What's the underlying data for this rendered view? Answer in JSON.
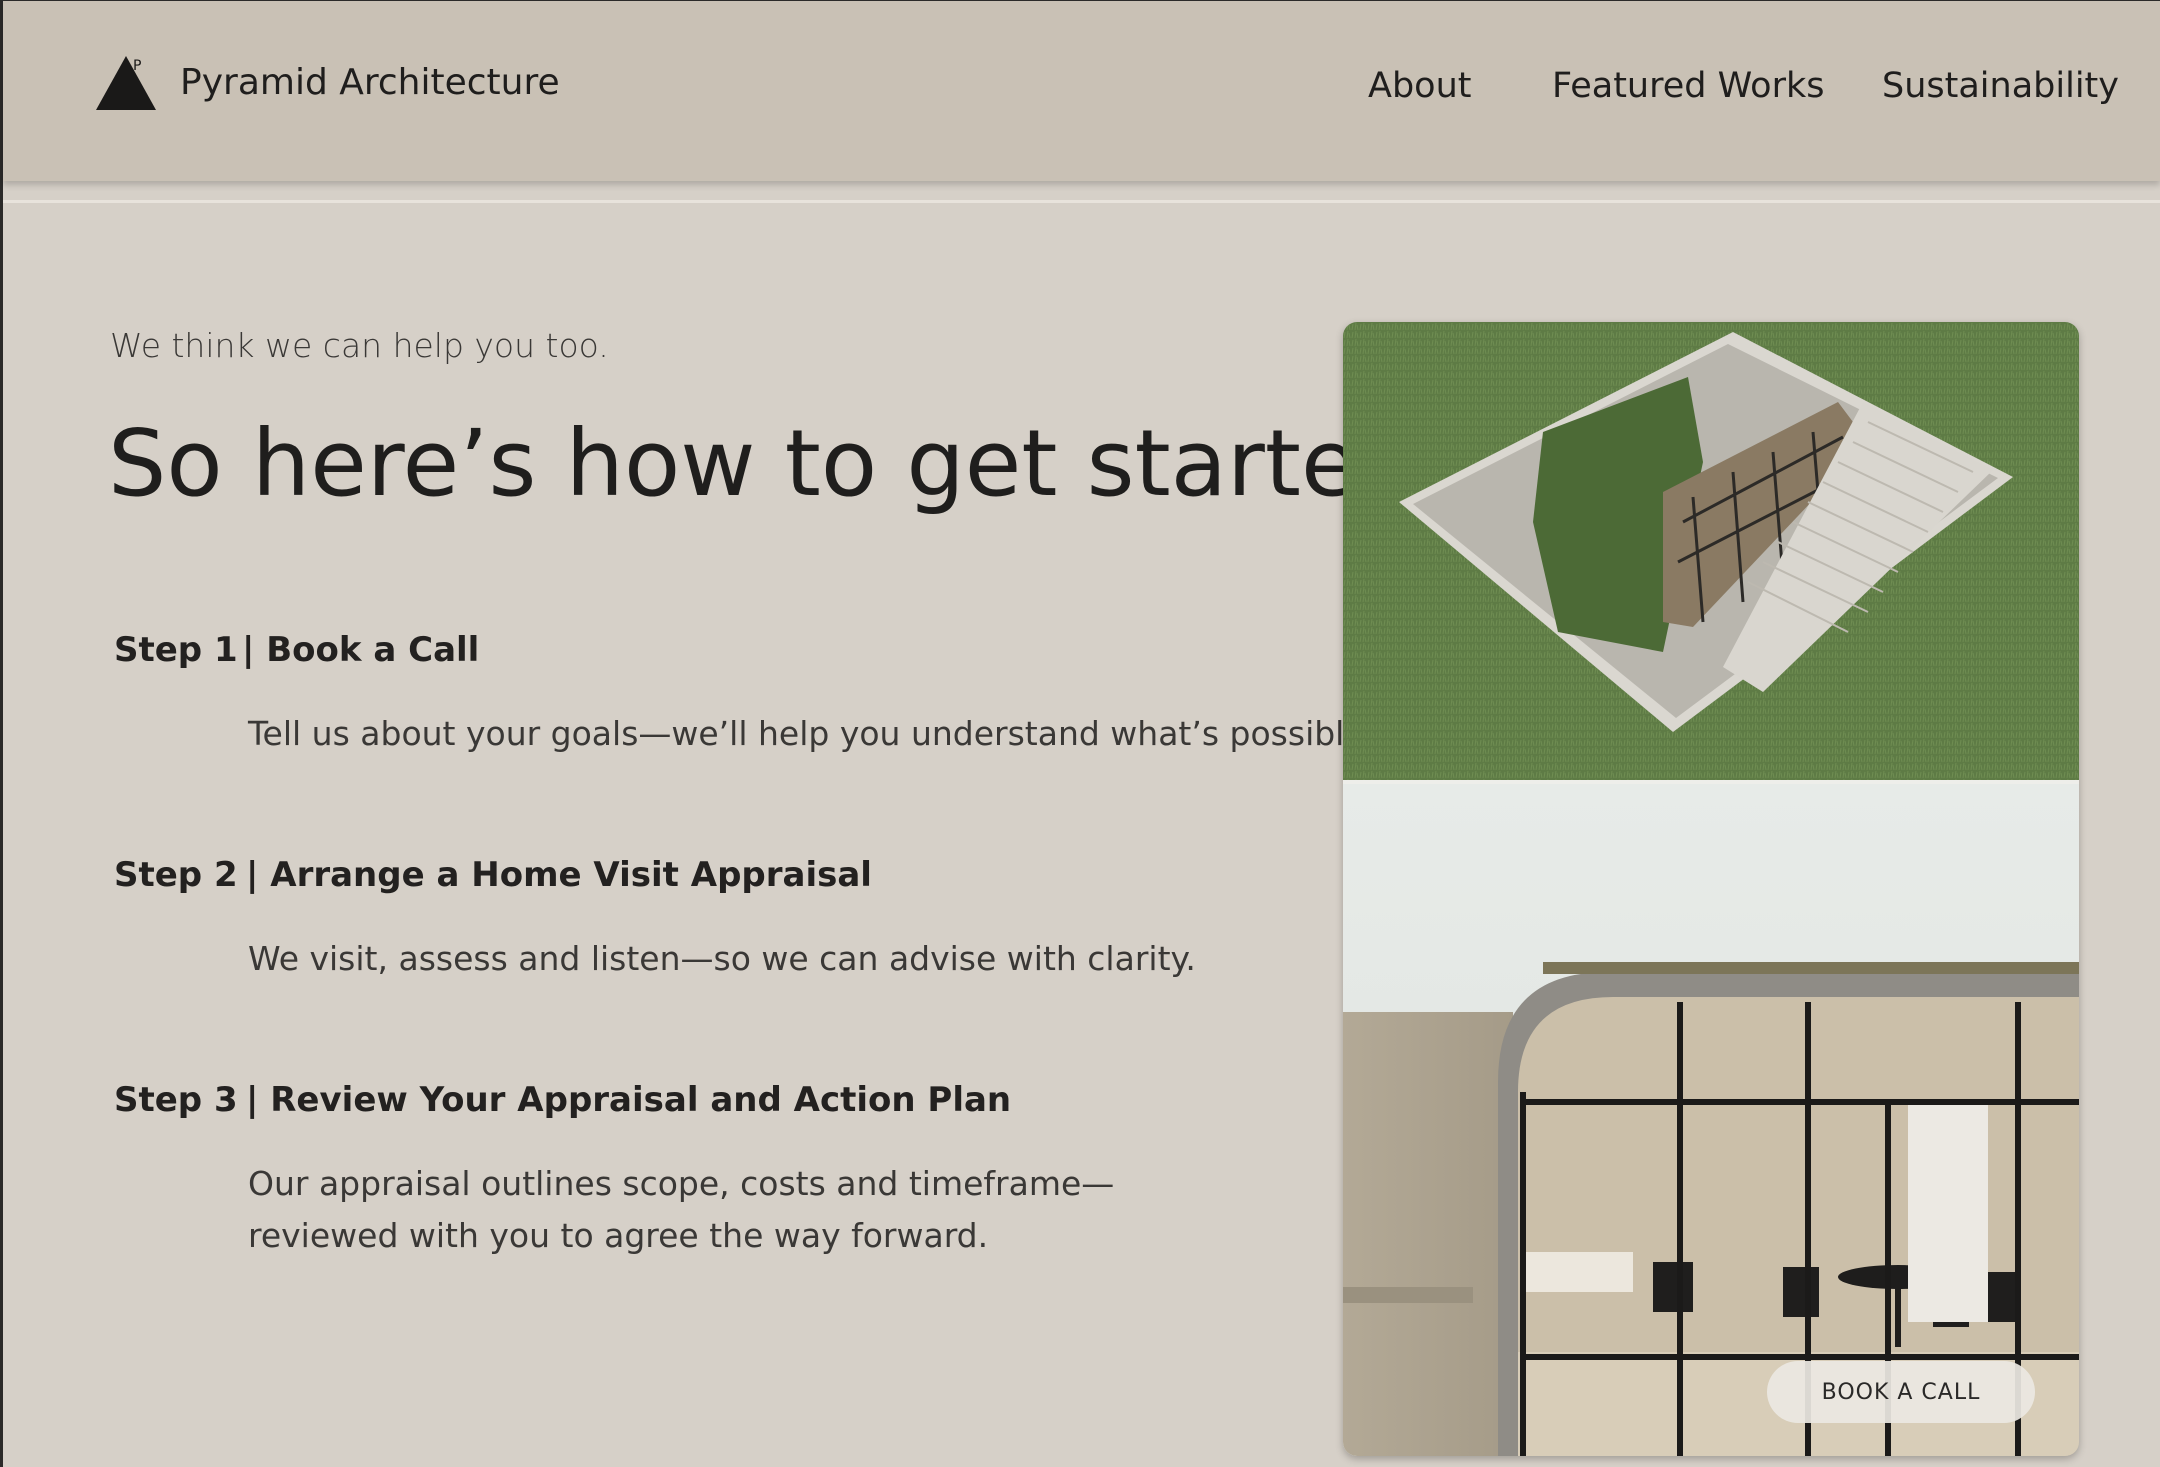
{
  "header": {
    "brand": "Pyramid Architecture",
    "nav": [
      "About",
      "Featured Works",
      "Sustainability"
    ]
  },
  "main": {
    "intro": "We think we can help you too.",
    "headline": "So here’s how to get started.",
    "steps": [
      {
        "number": "Step 1",
        "title": "| Book a Call",
        "description": [
          "Tell us about your goals—we’ll help you understand what’s possible."
        ]
      },
      {
        "number": "Step 2",
        "title": "| Arrange a Home Visit Appraisal",
        "description": [
          "We visit, assess and listen—so we can advise with clarity."
        ]
      },
      {
        "number": "Step 3",
        "title": "| Review Your Appraisal and Action Plan",
        "description": [
          "Our appraisal outlines scope, costs and timeframe—",
          "reviewed with you to agree the way forward."
        ]
      }
    ]
  },
  "cta": {
    "label": "BOOK A CALL"
  },
  "colors": {
    "page_background": "#d6d0c8",
    "header_background": "#c9c1b5",
    "text": "#232120",
    "grass": "#5d7a44"
  },
  "icons": {
    "logo": "pyramid-logo-icon"
  }
}
